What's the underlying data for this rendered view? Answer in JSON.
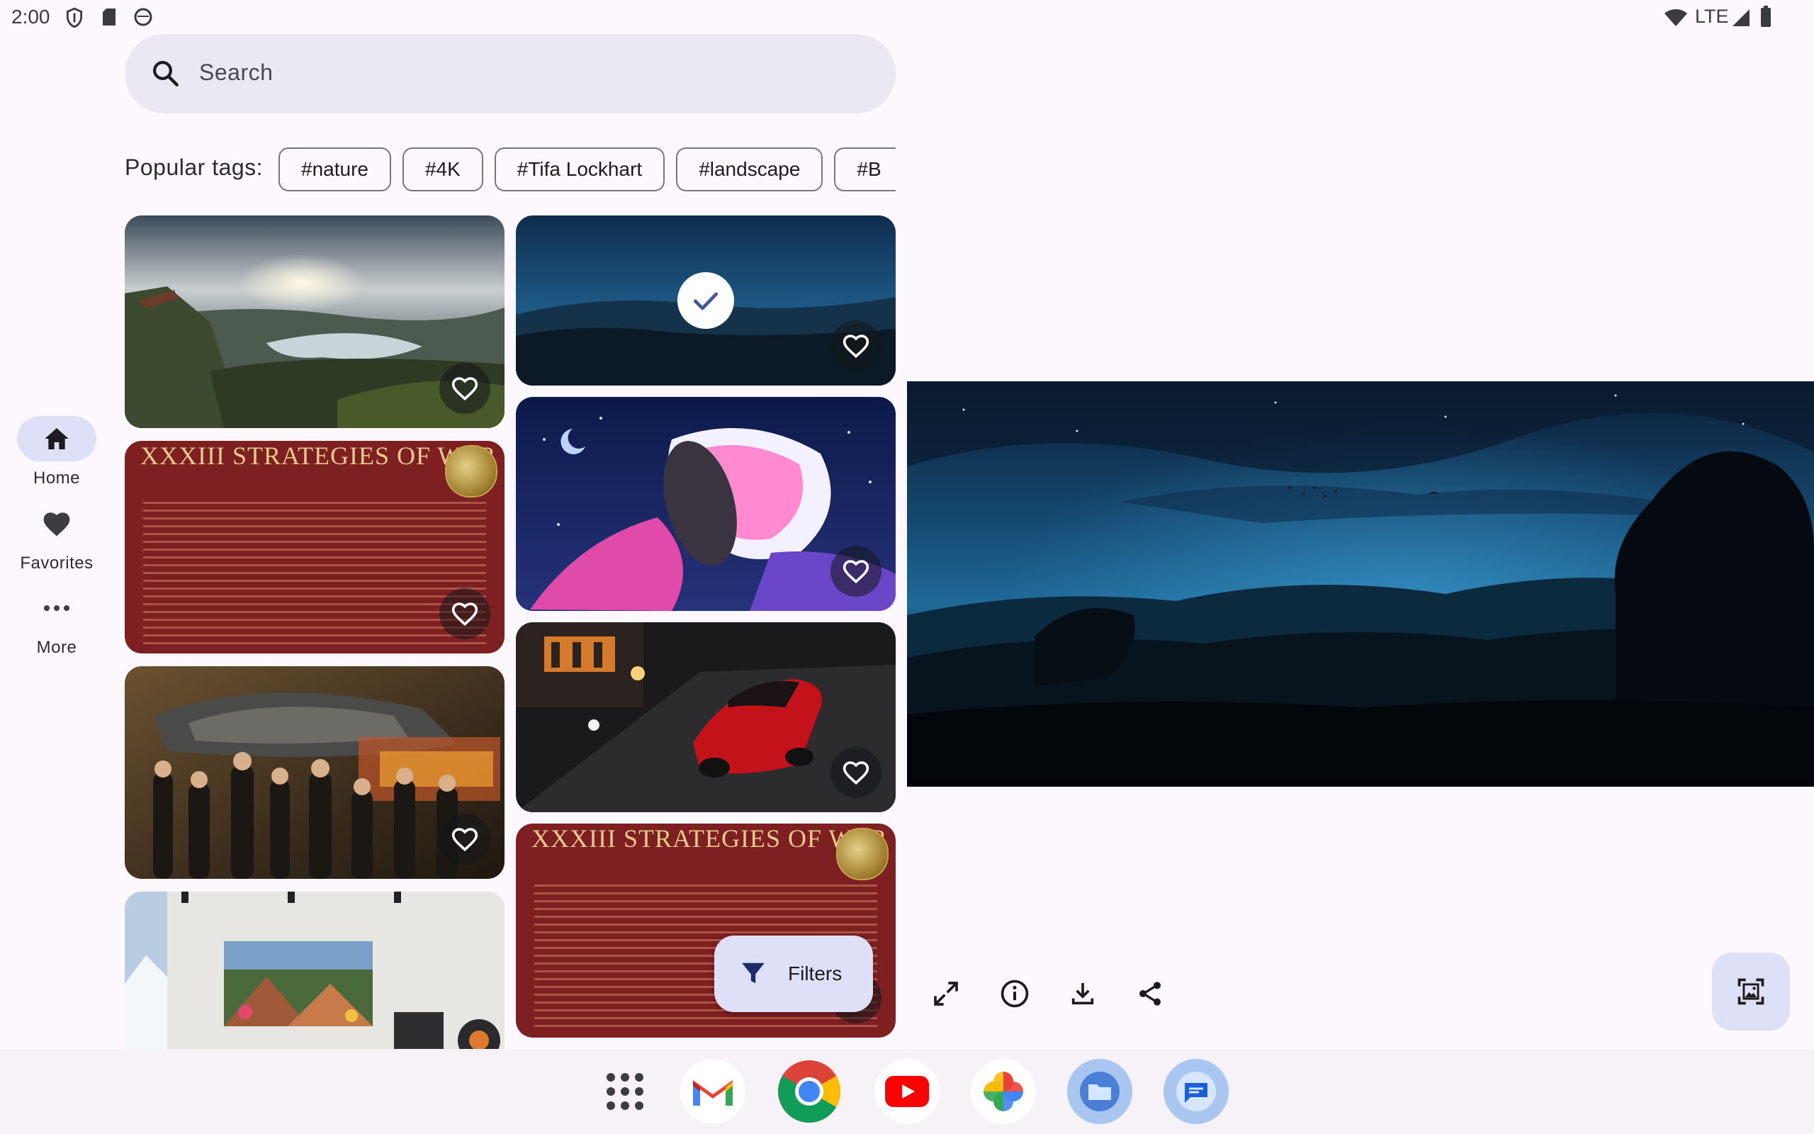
{
  "status_bar": {
    "time": "2:00",
    "network": "LTE",
    "icons": [
      "shield-icon",
      "sd-card-icon",
      "emoji-icon",
      "wifi-icon",
      "signal-icon",
      "battery-icon"
    ]
  },
  "nav": {
    "items": [
      {
        "label": "Home",
        "icon": "home-icon",
        "active": true
      },
      {
        "label": "Favorites",
        "icon": "heart-icon",
        "active": false
      },
      {
        "label": "More",
        "icon": "more-dots-icon",
        "active": false
      }
    ]
  },
  "search": {
    "placeholder": "Search"
  },
  "tags": {
    "label": "Popular tags:",
    "items": [
      "#nature",
      "#4K",
      "#Tifa Lockhart",
      "#landscape",
      "#B"
    ]
  },
  "grid": {
    "left_column": [
      {
        "subject": "mountain-lake",
        "favorite": false
      },
      {
        "subject": "strategies-document",
        "title": "XXXIII STRATEGIES OF WAR",
        "favorite": false
      },
      {
        "subject": "sci-fi-crew",
        "favorite": false
      },
      {
        "subject": "room-with-painting"
      }
    ],
    "right_column": [
      {
        "subject": "night-sky-landscape",
        "selected": true,
        "favorite": false
      },
      {
        "subject": "anime-character",
        "favorite": false
      },
      {
        "subject": "red-car-street",
        "favorite": false
      },
      {
        "subject": "strategies-document",
        "title": "XXXIII STRATEGIES OF WAR",
        "favorite": false
      }
    ]
  },
  "filters_button": {
    "label": "Filters",
    "icon": "filter-icon"
  },
  "preview": {
    "subject": "night-sky-landscape",
    "actions": [
      "fullscreen-icon",
      "info-icon",
      "download-icon",
      "share-icon"
    ],
    "set_wallpaper_icon": "wallpaper-icon"
  },
  "taskbar": {
    "apps": [
      "app-drawer",
      "Gmail",
      "Chrome",
      "YouTube",
      "Photos",
      "Files",
      "Messages"
    ]
  },
  "colors": {
    "background": "#fdf8fd",
    "surface_container": "#ebe7f3",
    "secondary_container": "#dee0f7",
    "document_red": "#7e1f22"
  }
}
